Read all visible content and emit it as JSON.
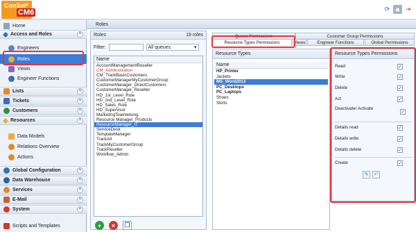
{
  "app": {
    "logo_text": "ConSol*",
    "logo_cm": "CM6"
  },
  "topbar": {
    "refresh_icon": "refresh-icon",
    "user_icon": "user-icon",
    "logout_icon": "logout-icon"
  },
  "sidebar": {
    "home": "Home",
    "access_and_roles": "Access and Roles",
    "engineers": "Engineers",
    "roles": "Roles",
    "views": "Views",
    "engineer_functions": "Engineer Functions",
    "lists": "Lists",
    "tickets": "Tickets",
    "customers": "Customers",
    "resources": "Resources",
    "data_models": "Data Models",
    "relations_overview": "Relations Overview",
    "actions": "Actions",
    "global_configuration": "Global Configuration",
    "data_warehouse": "Data Warehouse",
    "services": "Services",
    "email": "E-Mail",
    "system": "System",
    "scripts_and_templates": "Scripts and Templates"
  },
  "main": {
    "title": "Roles"
  },
  "roles_panel": {
    "title": "Roles",
    "count": "19 roles",
    "filter_label": "Filter:",
    "filter_value": "",
    "queue_select": "All queues",
    "column": "Name",
    "items": [
      "AccountManagementReseller",
      "CM_Administration",
      "CM_TrackBasicCustomers",
      "CustomerManagerMyCustomerGroup",
      "CustomerManager_DirectCustomers",
      "CustomerManager_Reseller",
      "HD_1st_Level_Role",
      "HD_2nd_Level_Role",
      "HD_Sales_Role",
      "HD_Supervisor",
      "MarketingTeamleitung",
      "Resource Manager_Products",
      "ResourceManager_IT",
      "ServiceDesk",
      "TemplateManager",
      "TrackAll",
      "TrackMyCustomerGroup",
      "TrackReseller",
      "Workflow_Admin"
    ]
  },
  "tabs": {
    "queue": "Queue Permissions",
    "customer_group": "Customer Group Permissions",
    "resource_types": "Resource Types Permissions",
    "views": "Views",
    "engineer_functions": "Engineer Functions",
    "global": "Global Permissions"
  },
  "resource_types": {
    "title": "Resource Types",
    "column": "Name",
    "items": [
      "HP_Printer",
      "Jackets",
      "MS_Word2013",
      "PC_Desktops",
      "PC_Laptops",
      "Shoes",
      "Skirts"
    ]
  },
  "permissions": {
    "title": "Resource Types Permissions",
    "read": "Read",
    "write": "Write",
    "delete": "Delete",
    "act": "Act",
    "deactivate": "Deactivate/ Activate",
    "details_read": "Details read",
    "details_write": "Details write",
    "details_delete": "Details delete",
    "create": "Create"
  },
  "colors": {
    "accent": "#3d7cd7",
    "highlight": "#e0363b",
    "logo": "#f39a1e"
  }
}
